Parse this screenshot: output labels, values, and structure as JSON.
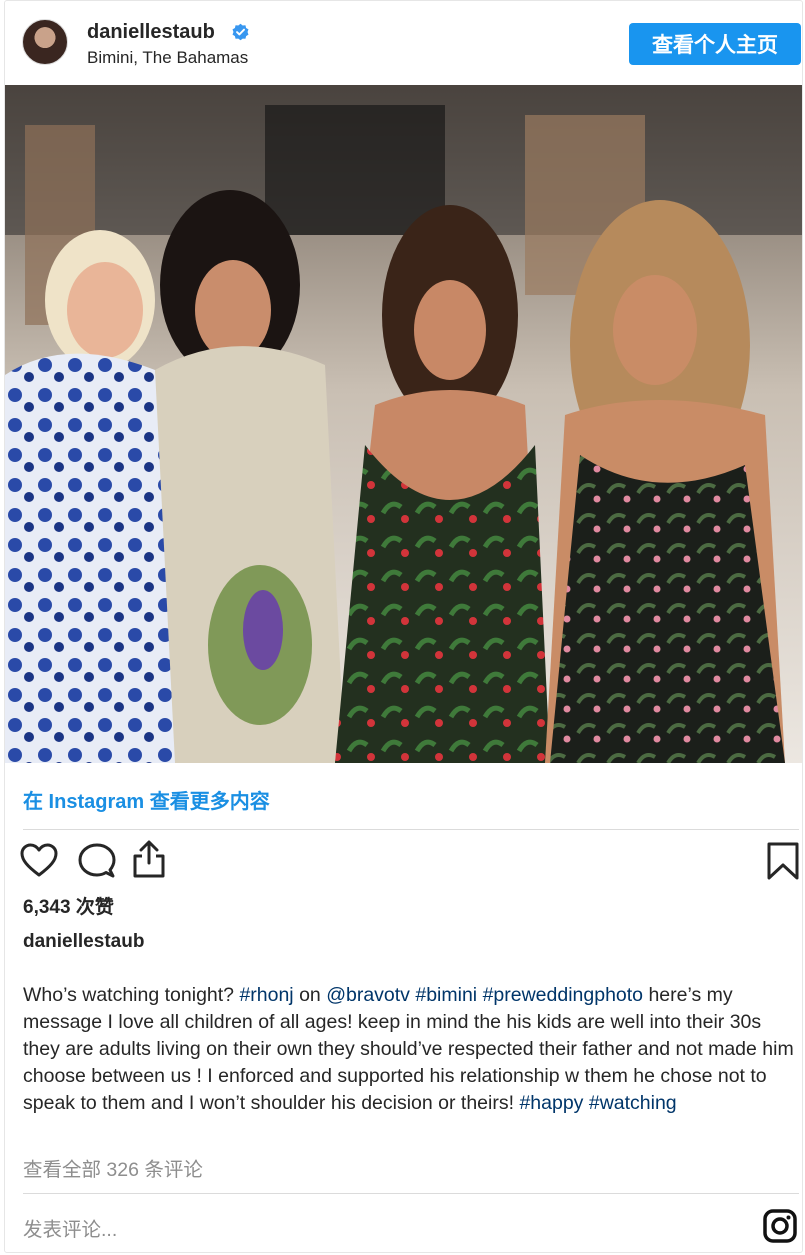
{
  "header": {
    "username": "daniellestaub",
    "location": "Bimini, The Bahamas",
    "profile_button": "查看个人主页"
  },
  "more_link": "在 Instagram 查看更多内容",
  "likes": "6,343 次赞",
  "owner": "daniellestaub",
  "caption": {
    "t1": "Who’s watching tonight? ",
    "h1": "#rhonj",
    "t2": " on ",
    "h2": "@bravotv",
    "t3": " ",
    "h3": "#bimini",
    "t4": " ",
    "h4": "#preweddingphoto",
    "t5": " here’s my message I love all children of all ages! keep in mind the his kids are well into their 30s they are adults living on their own they should’ve respected their father and not made him choose between us ! I enforced and supported his relationship w them he chose not to speak to them and I won’t shoulder his decision or theirs! ",
    "h5": "#happy",
    "t6": " ",
    "h6": "#watching"
  },
  "comments_link": "查看全部 326 条评论",
  "add_comment_placeholder": "发表评论...",
  "colors": {
    "accent": "#1995ef",
    "link": "#1a8fe3",
    "hashtag": "#003569",
    "muted": "#8e8e8e"
  },
  "icons": [
    "verified-badge-icon",
    "heart-icon",
    "comment-icon",
    "share-icon",
    "bookmark-icon",
    "instagram-icon"
  ]
}
